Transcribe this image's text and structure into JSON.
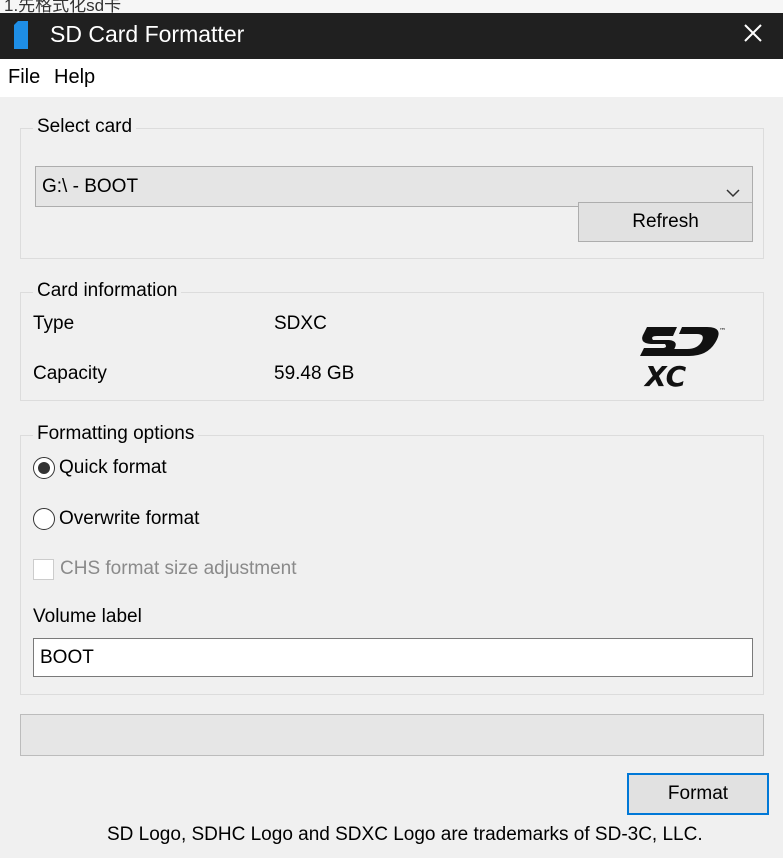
{
  "top_strip": {
    "text": "1.先格式化sd卡"
  },
  "window": {
    "title": "SD Card Formatter",
    "close_glyph": "✕",
    "icon": "sd-card-icon"
  },
  "menu": {
    "items": [
      "File",
      "Help"
    ]
  },
  "select_card": {
    "group_title": "Select card",
    "selected": "G:\\ - BOOT",
    "refresh_label": "Refresh"
  },
  "card_info": {
    "group_title": "Card information",
    "type_label": "Type",
    "type_value": "SDXC",
    "capacity_label": "Capacity",
    "capacity_value": "59.48 GB",
    "logo_icon": "sdxc-logo-icon"
  },
  "formatting": {
    "group_title": "Formatting options",
    "quick_label": "Quick format",
    "quick_selected": true,
    "overwrite_label": "Overwrite format",
    "overwrite_selected": false,
    "chs_label": "CHS format size adjustment",
    "chs_checked": false,
    "chs_enabled": false,
    "volume_label_caption": "Volume label",
    "volume_label_value": "BOOT"
  },
  "progress": {
    "percent": 0
  },
  "actions": {
    "format_label": "Format"
  },
  "footer": {
    "text": "SD Logo, SDHC Logo and SDXC Logo are trademarks of SD-3C, LLC."
  },
  "colors": {
    "titlebar_bg": "#202020",
    "accent": "#0078d7",
    "window_bg": "#f0f0f0",
    "app_icon": "#1e8ee6"
  }
}
